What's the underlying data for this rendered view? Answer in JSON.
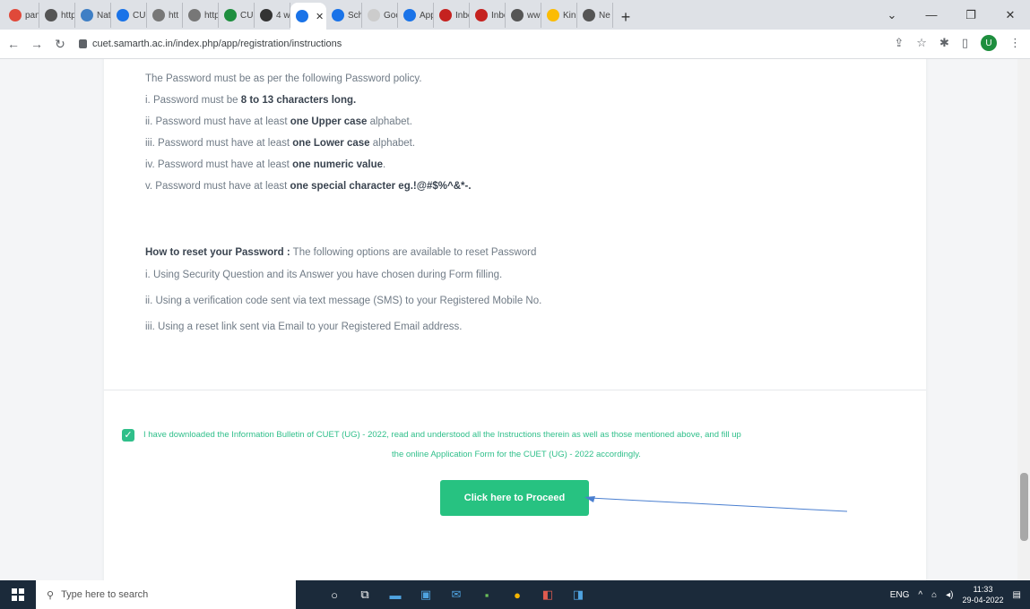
{
  "browser": {
    "tabs": [
      {
        "label": "pan",
        "color": "#e0493a"
      },
      {
        "label": "http",
        "color": "#555"
      },
      {
        "label": "Nat",
        "color": "#3f7fc5"
      },
      {
        "label": "CUI",
        "color": "#1a73e8"
      },
      {
        "label": "htt",
        "color": "#777"
      },
      {
        "label": "http",
        "color": "#777"
      },
      {
        "label": "CUI",
        "color": "#1e8e3e"
      },
      {
        "label": "4 w",
        "color": "#333"
      },
      {
        "label": "",
        "color": "#1a73e8",
        "active": true
      },
      {
        "label": "Sch",
        "color": "#1a73e8"
      },
      {
        "label": "Goo",
        "color": "#ccc"
      },
      {
        "label": "App",
        "color": "#1a73e8"
      },
      {
        "label": "Inbo",
        "color": "#c5221f"
      },
      {
        "label": "Inbo",
        "color": "#c5221f"
      },
      {
        "label": "ww",
        "color": "#555"
      },
      {
        "label": "Kin",
        "color": "#fbbc04"
      },
      {
        "label": "Ne",
        "color": "#555"
      }
    ],
    "url": "cuet.samarth.ac.in/index.php/app/registration/instructions",
    "profile_initial": "U"
  },
  "policy": {
    "intro": "The Password must be as per the following Password policy.",
    "rules": [
      {
        "prefix": "i. Password must be ",
        "bold": "8 to 13 characters long.",
        "suffix": ""
      },
      {
        "prefix": "ii. Password must have at least ",
        "bold": "one Upper case",
        "suffix": " alphabet."
      },
      {
        "prefix": "iii. Password must have at least ",
        "bold": "one Lower case",
        "suffix": " alphabet."
      },
      {
        "prefix": "iv. Password must have at least ",
        "bold": "one numeric value",
        "suffix": "."
      },
      {
        "prefix": "v. Password must have at least ",
        "bold": "one special character eg.!@#$%^&*-.",
        "suffix": ""
      }
    ]
  },
  "reset": {
    "heading": "How to reset your Password :",
    "heading_rest": " The following options are available to reset Password",
    "options": [
      "i. Using Security Question and its Answer you have chosen during Form filling.",
      "ii. Using a verification code sent via text message (SMS) to your Registered Mobile No.",
      "iii. Using a reset link sent via Email to your Registered Email address."
    ]
  },
  "agreement": {
    "line1": "I have downloaded the Information Bulletin of CUET (UG) - 2022, read and understood all the Instructions therein as well as those mentioned above, and fill up",
    "line2": "the online Application Form for the CUET (UG) - 2022 accordingly.",
    "checked": true
  },
  "proceed_label": "Click here to Proceed",
  "taskbar": {
    "search_placeholder": "Type here to search",
    "lang": "ENG",
    "time": "11:33",
    "date": "29-04-2022"
  }
}
